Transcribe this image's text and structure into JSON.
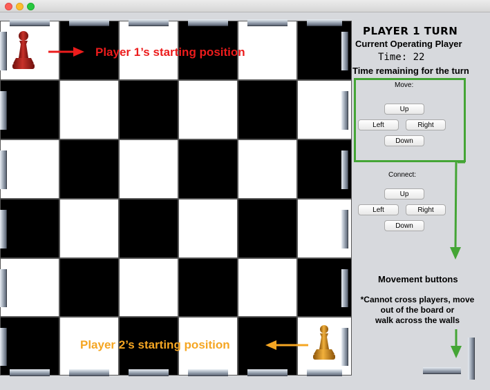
{
  "window": {
    "controls": [
      "close",
      "minimize",
      "zoom"
    ]
  },
  "board": {
    "rows": 6,
    "cols": 6,
    "top_left_color": "white",
    "wall_color": "#9aa4b2"
  },
  "pieces": {
    "player1": {
      "icon": "red-pawn-icon",
      "color": "#b3201b",
      "row": 0,
      "col": 0
    },
    "player2": {
      "icon": "gold-pawn-icon",
      "color": "#e39a1b",
      "row": 5,
      "col": 5
    }
  },
  "annotations": {
    "player1_start": "Player 1’s starting position",
    "player2_start": "Player 2’s starting position",
    "current_player_caption": "Current Operating Player",
    "time_caption": "Time remaining for the turn",
    "movement_buttons_caption": "Movement buttons",
    "rule_note_line1": "*Cannot cross players, move",
    "rule_note_line2": "out of the board or",
    "rule_note_line3": "walk across the walls",
    "red_color": "#ec1c1c",
    "orange_color": "#f5a623",
    "green_color": "#44a535"
  },
  "panel": {
    "turn_title": "PLAYER 1 TURN",
    "timer_label": "Time:",
    "timer_value": "22",
    "move": {
      "label": "Move:",
      "up": "Up",
      "left": "Left",
      "right": "Right",
      "down": "Down"
    },
    "connect": {
      "label": "Connect:",
      "up": "Up",
      "left": "Left",
      "right": "Right",
      "down": "Down"
    }
  }
}
